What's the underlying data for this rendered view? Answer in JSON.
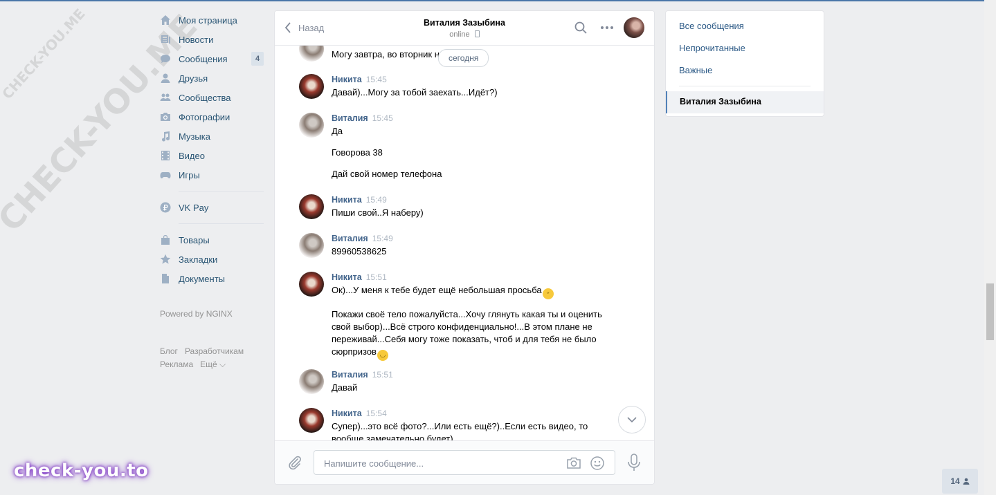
{
  "nav": {
    "items": [
      {
        "label": "Моя страница",
        "icon": "home-icon"
      },
      {
        "label": "Новости",
        "icon": "news-icon"
      },
      {
        "label": "Сообщения",
        "icon": "messages-icon",
        "badge": "4"
      },
      {
        "label": "Друзья",
        "icon": "friend-icon"
      },
      {
        "label": "Сообщества",
        "icon": "groups-icon"
      },
      {
        "label": "Фотографии",
        "icon": "camera-icon"
      },
      {
        "label": "Музыка",
        "icon": "music-icon"
      },
      {
        "label": "Видео",
        "icon": "video-icon"
      },
      {
        "label": "Игры",
        "icon": "gamepad-icon"
      },
      {
        "label": "VK Pay",
        "icon": "vkpay-icon"
      },
      {
        "label": "Товары",
        "icon": "bag-icon"
      },
      {
        "label": "Закладки",
        "icon": "star-icon"
      },
      {
        "label": "Документы",
        "icon": "document-icon"
      }
    ],
    "powered": "Powered by NGINX",
    "footer": {
      "blog": "Блог",
      "dev": "Разработчикам",
      "ads": "Реклама",
      "more": "Ещё ⌵"
    }
  },
  "chat": {
    "back_label": "Назад",
    "peer_name": "Виталия Зазыбина",
    "peer_status": "online",
    "date_pill": "сегодня",
    "partial_text": "Могу завтра, во вторник н",
    "messages": [
      {
        "author": "Никита",
        "time": "15:45",
        "lines": [
          "Давай)...Могу за тобой заехать...Идёт?)"
        ]
      },
      {
        "author": "Виталия",
        "time": "15:45",
        "lines": [
          "Да",
          "Говорова 38",
          "Дай свой номер телефона"
        ]
      },
      {
        "author": "Никита",
        "time": "15:49",
        "lines": [
          "Пиши свой..Я наберу)"
        ]
      },
      {
        "author": "Виталия",
        "time": "15:49",
        "lines": [
          "89960538625"
        ]
      },
      {
        "author": "Никита",
        "time": "15:51",
        "lines": [
          "Ок)...У меня к тебе будет ещё небольшая просьба",
          "Покажи своё тело пожалуйста...Хочу глянуть какая ты и оценить свой выбор)...Всё строго конфиденциально!...В этом плане не переживай...Себя могу тоже показать, чтоб и для тебя не было сюрпризов"
        ]
      },
      {
        "author": "Виталия",
        "time": "15:51",
        "lines": [
          "Давай"
        ]
      },
      {
        "author": "Никита",
        "time": "15:54",
        "lines": [
          "Супер)...это всё фото?...Или есть ещё?)..Если есть видео, то вообще замечательно будет)"
        ]
      }
    ],
    "compose_placeholder": "Напишите сообщение..."
  },
  "sidebar": {
    "all": "Все сообщения",
    "unread": "Непрочитанные",
    "important": "Важные",
    "active": "Виталия Зазыбина"
  },
  "counter": "14",
  "watermarks": {
    "diag_small": "CHECK-YOU.ME",
    "diag_big": "CHECK-YOU.ME",
    "bottom": "check-you.to"
  },
  "colors": {
    "accent": "#4a76a8",
    "link": "#2a5885",
    "author": "#42648b",
    "background": "#edeef0"
  }
}
